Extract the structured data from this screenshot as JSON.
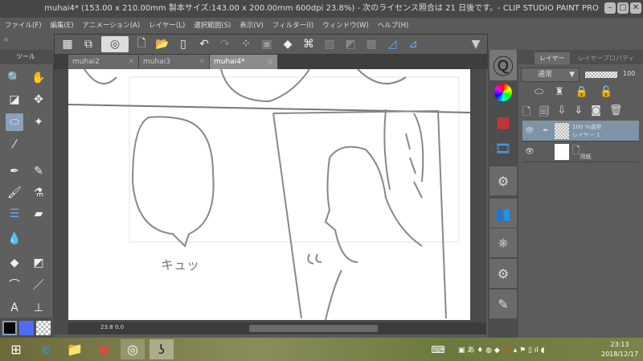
{
  "window": {
    "title": "muhai4* (153.00 x 210.00mm 製本サイズ:143.00 x 200.00mm 600dpi 23.8%)  - 次のライセンス照合は 21 日後です。- CLIP STUDIO PAINT PRO",
    "min": "–",
    "max": "□",
    "close": "✕"
  },
  "menu": [
    "ファイル(F)",
    "編集(E)",
    "アニメーション(A)",
    "レイヤー(L)",
    "選択範囲(S)",
    "表示(V)",
    "フィルター(I)",
    "ウィンドウ(W)",
    "ヘルプ(H)"
  ],
  "tabs": [
    {
      "label": "muhai2",
      "close": "✕"
    },
    {
      "label": "muhai3",
      "close": "✕"
    },
    {
      "label": "muhai4*",
      "close": "●"
    }
  ],
  "tool_panel": {
    "title": "ツール"
  },
  "layer_panel": {
    "tabs": [
      "レイヤー",
      "レイヤープロパティ"
    ],
    "blend_mode": "通常",
    "opacity": "100",
    "layers": [
      {
        "line1": "100 %通常",
        "line2": "レイヤー 1"
      },
      {
        "line1": "",
        "line2": "用紙"
      }
    ]
  },
  "canvas": {
    "sketch_text": "キュッ",
    "zoom": "23.8",
    "rotate": "0.0"
  },
  "taskbar": {
    "time": "23:13",
    "date": "2018/12/17"
  },
  "colors": {
    "main": "#000000",
    "sub": "#4f6cf7",
    "accent": "#8aa1bb"
  }
}
